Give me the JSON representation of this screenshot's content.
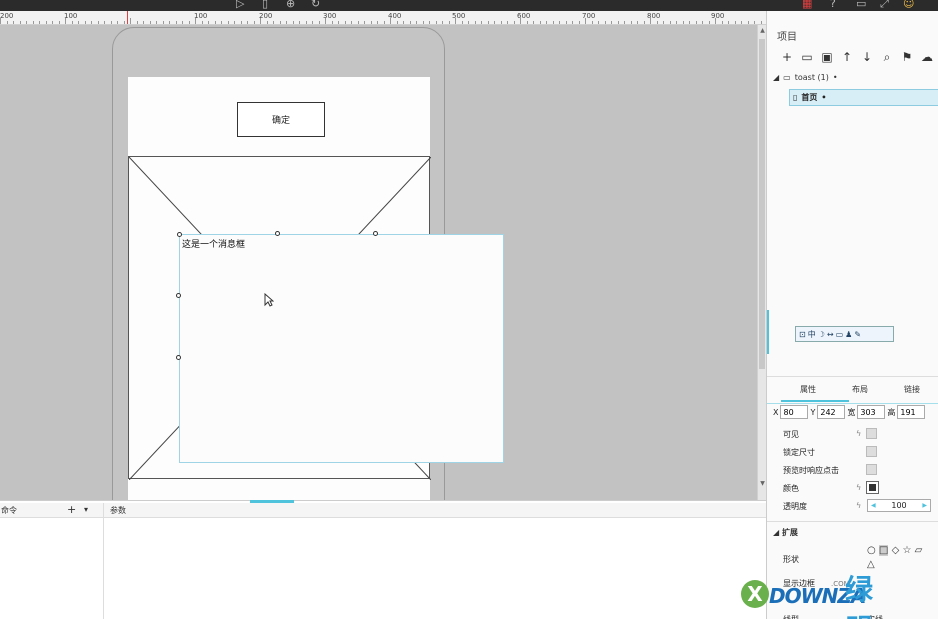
{
  "ruler": {
    "labels": [
      "200",
      "100",
      "100",
      "200",
      "300",
      "400",
      "500",
      "600",
      "700",
      "800",
      "900"
    ]
  },
  "canvas": {
    "confirm_button_label": "确定",
    "toast_text": "这是一个消息框"
  },
  "bottom_panel": {
    "commands_label": "命令",
    "params_label": "参数",
    "add_symbol": "+",
    "dropdown_symbol": "▾"
  },
  "project_panel": {
    "title": "项目",
    "tree": {
      "root_label": "toast (1)",
      "root_marker": "•",
      "page_label": "首页",
      "page_marker": "•"
    },
    "icon_strip": [
      "⊡",
      "中",
      "☽",
      "↔",
      "▭",
      "♟",
      "✎"
    ]
  },
  "properties": {
    "tabs": [
      "属性",
      "布局",
      "链接"
    ],
    "x_label": "X",
    "x_value": "80",
    "y_label": "Y",
    "y_value": "242",
    "width_label": "宽",
    "width_value": "303",
    "height_label": "高",
    "height_value": "191",
    "visible_label": "可见",
    "lock_size_label": "锁定尺寸",
    "preview_response_label": "预览时响应点击",
    "color_label": "颜色",
    "opacity_label": "透明度",
    "opacity_value": "100"
  },
  "extend": {
    "header": "扩展",
    "shape_label": "形状",
    "border_label": "显示边框",
    "line_label": "线型",
    "line_value": "实线"
  },
  "watermark": {
    "brand": "DOWNZA",
    "suffix": ".COM",
    "cn": "绿盟"
  }
}
